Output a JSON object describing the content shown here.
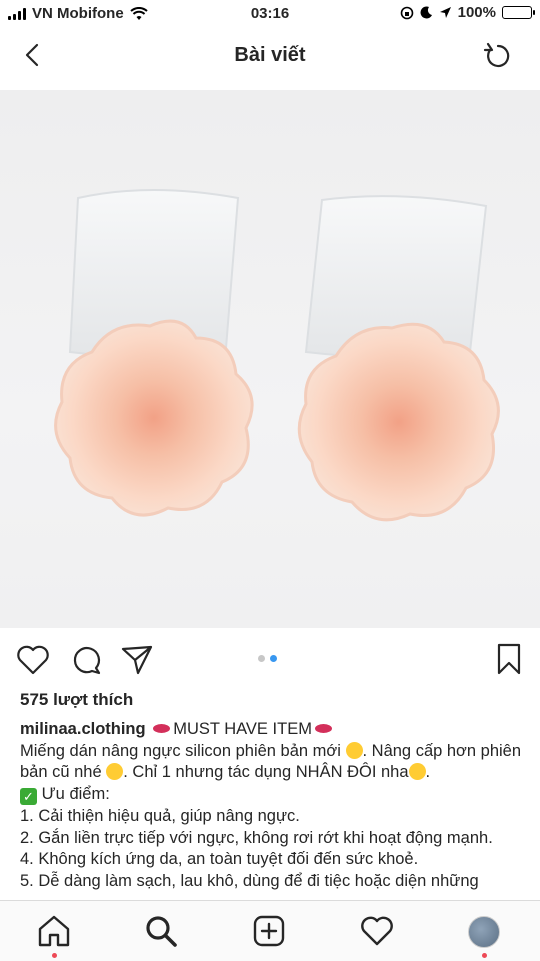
{
  "status": {
    "carrier": "VN Mobifone",
    "time": "03:16",
    "battery": "100%"
  },
  "header": {
    "title": "Bài viết"
  },
  "post": {
    "likes": "575 lượt thích",
    "username": "milinaa.clothing",
    "headline": "MUST HAVE ITEM",
    "line1a": "Miếng dán nâng ngực silicon phiên bản mới",
    "line1b": ". Nâng cấp hơn phiên bản cũ nhé",
    "line1c": ". Chỉ 1 nhưng tác dụng NHÂN ĐÔI nha",
    "line1d": ".",
    "pros": "Ưu điểm:",
    "items": [
      "1. Cải thiện hiệu quả, giúp nâng ngực.",
      "2. Gắn liền trực tiếp với ngực, không rơi rớt khi hoạt động mạnh.",
      "4. Không kích ứng da, an toàn tuyệt đối đến sức khoẻ.",
      "5. Dễ dàng làm sạch, lau khô, dùng để đi tiệc hoặc diện những"
    ]
  },
  "carousel": {
    "count": 2,
    "active": 2
  },
  "colors": {
    "accent": "#3897f0",
    "notification": "#ed4956",
    "battery": "#f2c300"
  },
  "icons": [
    "back-icon",
    "refresh-icon",
    "heart-icon",
    "comment-icon",
    "share-icon",
    "bookmark-icon",
    "home-icon",
    "search-icon",
    "add-icon",
    "activity-icon"
  ]
}
